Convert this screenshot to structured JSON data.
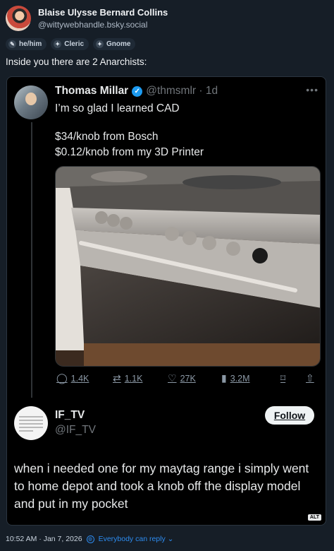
{
  "author": {
    "name": "Blaise Ulysse Bernard Collins",
    "handle": "@wittywebhandle.bsky.social"
  },
  "labels": [
    {
      "icon": "pronoun-icon",
      "glyph": "✎",
      "text": "he/him"
    },
    {
      "icon": "class-icon",
      "glyph": "✦",
      "text": "Cleric"
    },
    {
      "icon": "race-icon",
      "glyph": "✦",
      "text": "Gnome"
    }
  ],
  "post": {
    "text": "Inside you there are 2 Anarchists:"
  },
  "quoted_tweet": {
    "name": "Thomas Millar",
    "verified_glyph": "✓",
    "handle_time": "@thmsmlr · 1d",
    "lines": [
      "I’m so glad I learned CAD",
      "$34/knob from Bosch",
      "$0.12/knob from my 3D Printer"
    ],
    "more_glyph": "•••",
    "actions": {
      "replies": {
        "icon": "reply-icon",
        "glyph": "◯",
        "count": "1.4K"
      },
      "reposts": {
        "icon": "repost-icon",
        "glyph": "⇄",
        "count": "1.1K"
      },
      "likes": {
        "icon": "heart-icon",
        "glyph": "♡",
        "count": "27K"
      },
      "views": {
        "icon": "views-icon",
        "glyph": "▮",
        "count": "3.2M"
      },
      "bookmark_glyph": "⌑",
      "share_glyph": "⇧"
    },
    "reply": {
      "name": "IF_TV",
      "handle": "@IF_TV",
      "follow_label": "Follow",
      "text": "when i needed one for my maytag range i simply went to home depot and took a knob off the display model and put in my pocket"
    },
    "alt_badge": "ALT"
  },
  "footer": {
    "time": "10:52 AM · Jan 7, 2026",
    "globe_glyph": "◍",
    "reply_setting": "Everybody can reply ⌄"
  },
  "colors": {
    "background": "#161e27",
    "accent": "#2d8cf0",
    "verified": "#1d9bf0"
  }
}
